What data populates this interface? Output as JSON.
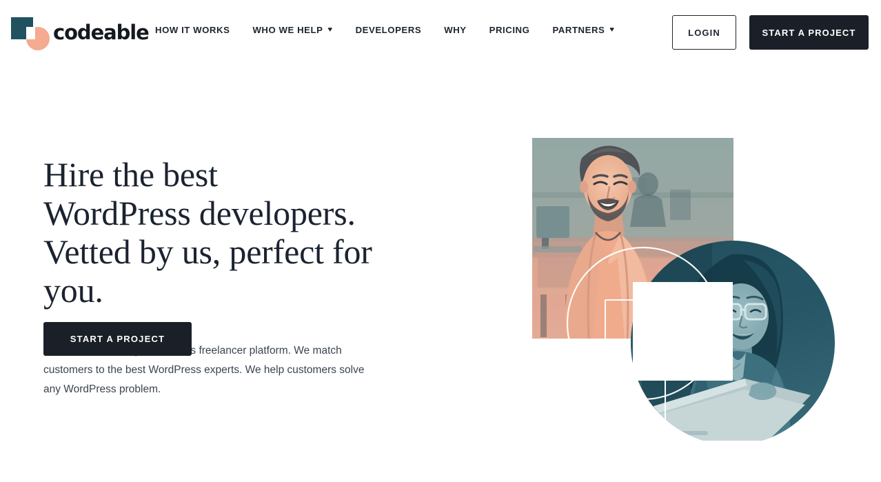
{
  "brand": {
    "name": "codeable",
    "logo_icon": "codeable-logo-square-circle",
    "colors": {
      "square": "#20525f",
      "circle": "#f4ab8f"
    }
  },
  "nav": {
    "items": [
      {
        "label": "HOW IT WORKS",
        "has_dropdown": false,
        "caret_icon": ""
      },
      {
        "label": "WHO WE HELP",
        "has_dropdown": true,
        "caret_icon": "chevron-down-icon"
      },
      {
        "label": "DEVELOPERS",
        "has_dropdown": false,
        "caret_icon": ""
      },
      {
        "label": "WHY",
        "has_dropdown": false,
        "caret_icon": ""
      },
      {
        "label": "PRICING",
        "has_dropdown": false,
        "caret_icon": ""
      },
      {
        "label": "PARTNERS",
        "has_dropdown": true,
        "caret_icon": "chevron-down-icon"
      }
    ],
    "caret_glyph": "♥"
  },
  "header_actions": {
    "login_label": "LOGIN",
    "start_project_label": "START A PROJECT",
    "login_color": "#1d2430",
    "start_project_bg": "#1b2028"
  },
  "hero": {
    "title_lines": [
      "Hire the best",
      "WordPress developers.",
      "Vetted by us, perfect for",
      "you."
    ],
    "title_full": "Hire the best WordPress developers. Vetted by us, perfect for you.",
    "subtitle": "Codeable is the only WordPress freelancer platform. We match customers to the best WordPress experts. We help customers solve any WordPress problem.",
    "cta_label": "START A PROJECT",
    "title_color": "#1b2330",
    "subtitle_color": "#3b4450"
  },
  "hero_art": {
    "alt": "Collage of two smiling WordPress developers",
    "square_photo": {
      "name": "photo-developer-man",
      "tint": "#f0a58c",
      "description": "Smiling bearded man in an office, peach duotone, square crop"
    },
    "circle_photo": {
      "name": "photo-developer-woman",
      "tint": "#2b5a68",
      "description": "Smiling woman with glasses at a laptop, teal duotone, circular crop"
    },
    "white_square": {
      "name": "white-overlay-square",
      "color": "#ffffff"
    },
    "decor": {
      "circle_outline": "white-circle-outline",
      "square_outline_small": "white-square-outline-small",
      "square_outline_large": "white-square-outline-large",
      "stroke_color": "#ffffff"
    }
  }
}
